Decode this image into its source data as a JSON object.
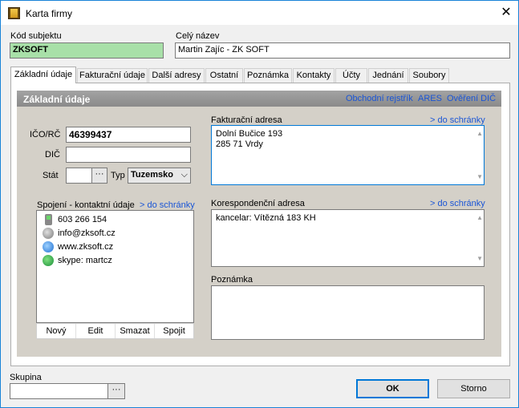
{
  "window": {
    "title": "Karta firmy",
    "close_glyph": "✕"
  },
  "header": {
    "kod_label": "Kód subjektu",
    "kod_value": "ZKSOFT",
    "nazev_label": "Celý název",
    "nazev_value": "Martin Zajíc - ZK SOFT"
  },
  "tabs": [
    {
      "label": "Základní údaje",
      "active": true
    },
    {
      "label": "Fakturační údaje"
    },
    {
      "label": "Další adresy"
    },
    {
      "label": "Ostatní"
    },
    {
      "label": "Poznámka"
    },
    {
      "label": "Kontakty"
    },
    {
      "label": "Účty"
    },
    {
      "label": "Jednání"
    },
    {
      "label": "Soubory"
    }
  ],
  "panel": {
    "title": "Základní údaje",
    "links": {
      "obchodni": "Obchodní rejstřík",
      "ares": "ARES",
      "overeni": "Ověření DIČ"
    }
  },
  "form": {
    "ico_label": "IČO/RČ",
    "ico_value": "46399437",
    "dic_label": "DIČ",
    "dic_value": "",
    "stat_label": "Stát",
    "stat_value": "",
    "typ_label": "Typ",
    "typ_value": "Tuzemsko",
    "dots": "···"
  },
  "contacts": {
    "label": "Spojení -  kontaktní údaje",
    "link": "> do schránky",
    "items": [
      {
        "icon": "phone-icon",
        "text": "603 266 154"
      },
      {
        "icon": "mail-icon",
        "text": "info@zksoft.cz"
      },
      {
        "icon": "web-icon",
        "text": "www.zksoft.cz"
      },
      {
        "icon": "skype-icon",
        "text": "skype: martcz"
      }
    ],
    "buttons": {
      "new": "Nový",
      "edit": "Edit",
      "delete": "Smazat",
      "join": "Spojit"
    }
  },
  "fakturacni": {
    "label": "Fakturační adresa",
    "link": "> do schránky",
    "line1": "Dolní Bučice 193",
    "line2": "285 71 Vrdy"
  },
  "korespondencni": {
    "label": "Korespondenční adresa",
    "link": "> do schránky",
    "line1": "kancelar: Vítězná 183 KH"
  },
  "poznamka": {
    "label": "Poznámka",
    "value": ""
  },
  "footer": {
    "skupina_label": "Skupina",
    "skupina_value": "",
    "ok": "OK",
    "storno": "Storno"
  }
}
